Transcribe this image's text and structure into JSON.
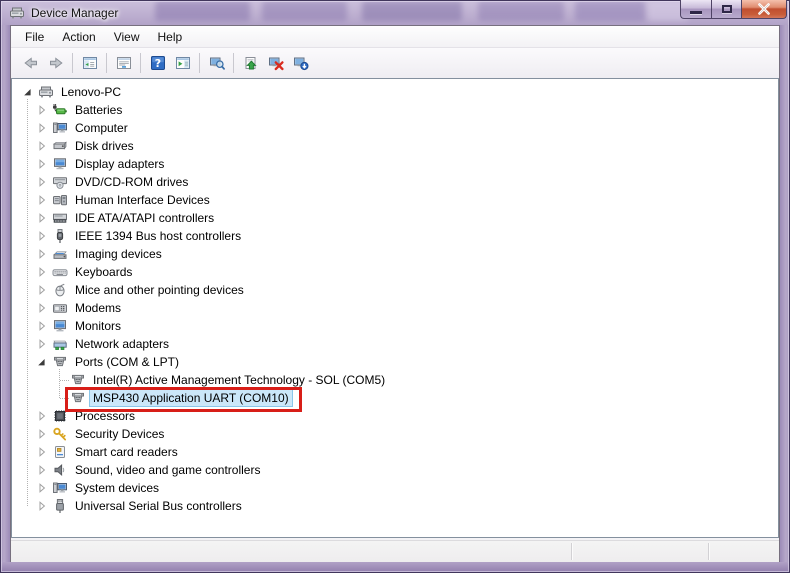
{
  "window": {
    "title": "Device Manager",
    "title_icon": "device-manager-icon",
    "controls": [
      {
        "name": "minimize-button",
        "icon": "minimize-icon"
      },
      {
        "name": "maximize-button",
        "icon": "maximize-icon"
      },
      {
        "name": "close-button",
        "icon": "close-x-icon"
      }
    ]
  },
  "menu": {
    "items": [
      "File",
      "Action",
      "View",
      "Help"
    ]
  },
  "toolbar": {
    "buttons": [
      {
        "name": "back-button",
        "icon": "back-arrow-icon"
      },
      {
        "name": "forward-button",
        "icon": "forward-arrow-icon"
      },
      {
        "type": "separator"
      },
      {
        "name": "console-tree-button",
        "icon": "console-tree-icon"
      },
      {
        "type": "separator"
      },
      {
        "name": "properties-button",
        "icon": "properties-window-icon"
      },
      {
        "type": "separator"
      },
      {
        "name": "help-button",
        "icon": "help-icon"
      },
      {
        "name": "action-pane-button",
        "icon": "action-pane-icon"
      },
      {
        "type": "separator"
      },
      {
        "name": "device-search-button",
        "icon": "computer-search-icon"
      },
      {
        "type": "separator"
      },
      {
        "name": "update-driver-button",
        "icon": "driver-update-icon"
      },
      {
        "name": "uninstall-device-button",
        "icon": "computer-remove-icon"
      },
      {
        "name": "hardware-changes-button",
        "icon": "computer-download-icon"
      }
    ]
  },
  "tree": {
    "items": [
      {
        "label": "Lenovo-PC",
        "level": 0,
        "expander": "expanded",
        "icon": "computer-system-icon"
      },
      {
        "label": "Batteries",
        "level": 1,
        "expander": "collapsed",
        "icon": "battery-icon"
      },
      {
        "label": "Computer",
        "level": 1,
        "expander": "collapsed",
        "icon": "computer-icon"
      },
      {
        "label": "Disk drives",
        "level": 1,
        "expander": "collapsed",
        "icon": "disk-drive-icon"
      },
      {
        "label": "Display adapters",
        "level": 1,
        "expander": "collapsed",
        "icon": "display-adapter-icon"
      },
      {
        "label": "DVD/CD-ROM drives",
        "level": 1,
        "expander": "collapsed",
        "icon": "dvd-drive-icon"
      },
      {
        "label": "Human Interface Devices",
        "level": 1,
        "expander": "collapsed",
        "icon": "hid-icon"
      },
      {
        "label": "IDE ATA/ATAPI controllers",
        "level": 1,
        "expander": "collapsed",
        "icon": "ide-controller-icon"
      },
      {
        "label": "IEEE 1394 Bus host controllers",
        "level": 1,
        "expander": "collapsed",
        "icon": "ieee1394-icon"
      },
      {
        "label": "Imaging devices",
        "level": 1,
        "expander": "collapsed",
        "icon": "imaging-device-icon"
      },
      {
        "label": "Keyboards",
        "level": 1,
        "expander": "collapsed",
        "icon": "keyboard-icon"
      },
      {
        "label": "Mice and other pointing devices",
        "level": 1,
        "expander": "collapsed",
        "icon": "mouse-icon"
      },
      {
        "label": "Modems",
        "level": 1,
        "expander": "collapsed",
        "icon": "modem-icon"
      },
      {
        "label": "Monitors",
        "level": 1,
        "expander": "collapsed",
        "icon": "monitor-icon"
      },
      {
        "label": "Network adapters",
        "level": 1,
        "expander": "collapsed",
        "icon": "network-adapter-icon"
      },
      {
        "label": "Ports (COM & LPT)",
        "level": 1,
        "expander": "expanded",
        "icon": "serial-port-icon"
      },
      {
        "label": "Intel(R) Active Management Technology - SOL (COM5)",
        "level": 2,
        "expander": "none",
        "icon": "serial-port-icon"
      },
      {
        "label": "MSP430 Application UART (COM10)",
        "level": 2,
        "expander": "none",
        "icon": "serial-port-icon",
        "selected": true,
        "annotated": true
      },
      {
        "label": "Processors",
        "level": 1,
        "expander": "collapsed",
        "icon": "processor-icon"
      },
      {
        "label": "Security Devices",
        "level": 1,
        "expander": "collapsed",
        "icon": "security-key-icon"
      },
      {
        "label": "Smart card readers",
        "level": 1,
        "expander": "collapsed",
        "icon": "smart-card-icon"
      },
      {
        "label": "Sound, video and game controllers",
        "level": 1,
        "expander": "collapsed",
        "icon": "speaker-icon"
      },
      {
        "label": "System devices",
        "level": 1,
        "expander": "collapsed",
        "icon": "system-device-icon"
      },
      {
        "label": "Universal Serial Bus controllers",
        "level": 1,
        "expander": "collapsed",
        "icon": "usb-icon"
      }
    ]
  },
  "status_bar": {
    "text": ""
  },
  "colors": {
    "titlebar_glass": "#b7a8cb",
    "close_button": "#c85c38",
    "selection_bg": "#cbe7f9",
    "selection_border": "#8bc6e9",
    "annotation_red": "#d81e18",
    "tree_background": "#ffffff",
    "statusbar_bg": "#f0f0f0"
  }
}
